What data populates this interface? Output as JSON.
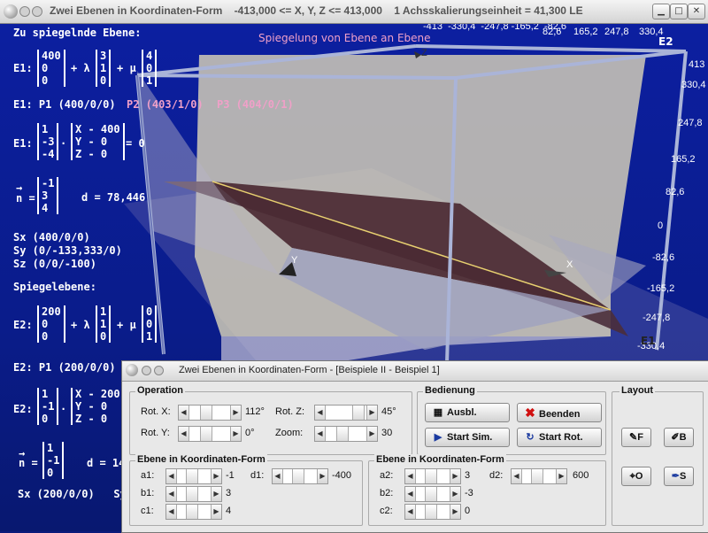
{
  "window": {
    "title": "Zwei Ebenen in Koordinaten-Form    -413,000 <= X, Y, Z <= 413,000    1 Achsskalierungseinheit = 41,300 LE"
  },
  "scene": {
    "heading_mirror": "Zu spiegelnde Ebene:",
    "e1_param": {
      "label": "E1:",
      "v0": [
        "400",
        "0",
        "0"
      ],
      "plus_lambda": "+ λ",
      "v1": [
        "3",
        "1",
        "0"
      ],
      "plus_mu": "+ μ",
      "v2": [
        "4",
        "0",
        "1"
      ]
    },
    "e1_points": [
      "E1: P1 (400/0/0)",
      "P2 (403/1/0)",
      "P3 (404/0/1)"
    ],
    "e1_normal": {
      "label": "E1:",
      "n": [
        "1",
        "-3",
        "-4"
      ],
      "dot": "·",
      "xyz": [
        "X - 400",
        "Y - 0",
        "Z - 0"
      ],
      "rhs": "= 0"
    },
    "e1_nvec": {
      "arrow": "→",
      "label": "n =",
      "n": [
        "-1",
        "3",
        "4"
      ],
      "d": "d = 78,446"
    },
    "e1_traces": [
      "Sx (400/0/0)",
      "Sy (0/-133,333/0)",
      "Sz (0/0/-100)"
    ],
    "heading_mirror_plane": "Spiegelebene:",
    "e2_param": {
      "label": "E2:",
      "v0": [
        "200",
        "0",
        "0"
      ],
      "plus_lambda": "+ λ",
      "v1": [
        "1",
        "1",
        "0"
      ],
      "plus_mu": "+ μ",
      "v2": [
        "0",
        "0",
        "1"
      ]
    },
    "e2_points": "E2: P1 (200/0/0)",
    "e2_normal": {
      "label": "E2:",
      "n": [
        "1",
        "-1",
        "0"
      ],
      "dot": "·",
      "xyz": [
        "X - 200",
        "Y - 0",
        "Z - 0"
      ]
    },
    "e2_nvec": {
      "arrow": "→",
      "label": "n =",
      "n": [
        "1",
        "-1",
        "0"
      ],
      "d": "d = 14"
    },
    "e2_traces": "Sx (200/0/0)   Sy",
    "top_title": "Spiegelung von Ebene an Ebene",
    "top_axis_labels": "-413  -330,4  -247,8 -165,2  -82,6",
    "right_axis_top": [
      "82,6",
      "165,2",
      "247,8",
      "330,4"
    ],
    "right_axis": [
      "413",
      "330,4",
      "247,8",
      "165,2",
      "82,6",
      "0",
      "-82,6",
      "-165,2",
      "-247,8",
      "-330,4"
    ],
    "plane_labels": {
      "e2": "E2",
      "e1": "E1"
    },
    "axis_letters": {
      "x": "X",
      "y": "Y",
      "z": "Z"
    }
  },
  "dialog": {
    "title": "Zwei Ebenen in Koordinaten-Form - [Beispiele II - Beispiel 1]",
    "operation": {
      "title": "Operation",
      "rot_x_label": "Rot. X:",
      "rot_x_value": "112°",
      "rot_z_label": "Rot. Z:",
      "rot_z_value": "45°",
      "rot_y_label": "Rot. Y:",
      "rot_y_value": "0°",
      "zoom_label": "Zoom:",
      "zoom_value": "30"
    },
    "bedienung": {
      "title": "Bedienung",
      "ausbl": "Ausbl.",
      "beenden": "Beenden",
      "start_sim": "Start Sim.",
      "start_rot": "Start Rot."
    },
    "layout": {
      "title": "Layout",
      "f": "F",
      "b": "B",
      "o": "O",
      "s": "S"
    },
    "ebene1": {
      "title": "Ebene in Koordinaten-Form",
      "a1_label": "a1:",
      "a1_value": "-1",
      "b1_label": "b1:",
      "b1_value": "3",
      "c1_label": "c1:",
      "c1_value": "4",
      "d1_label": "d1:",
      "d1_value": "-400"
    },
    "ebene2": {
      "title": "Ebene in Koordinaten-Form",
      "a2_label": "a2:",
      "a2_value": "3",
      "b2_label": "b2:",
      "b2_value": "-3",
      "c2_label": "c2:",
      "c2_value": "0",
      "d2_label": "d2:",
      "d2_value": "600"
    }
  }
}
